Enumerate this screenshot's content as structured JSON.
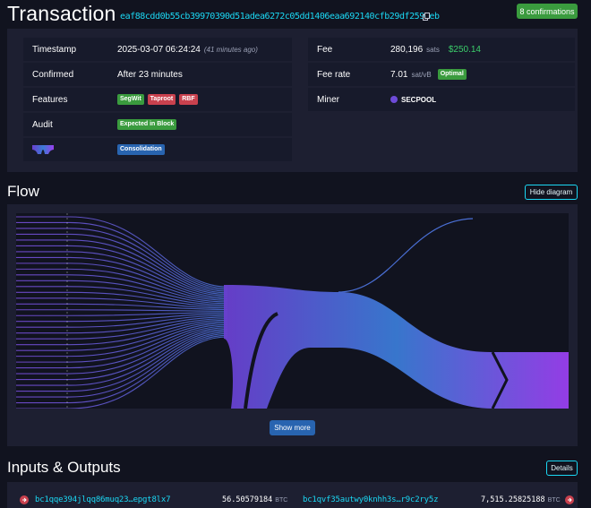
{
  "header": {
    "title": "Transaction",
    "txid": "eaf88cdd0b55cb39970390d51adea6272c05dd1406eaa692140cfb29df2599eb",
    "confirmations": "8 confirmations"
  },
  "details": {
    "timestamp": {
      "label": "Timestamp",
      "value": "2025-03-07 06:24:24",
      "relative": "(41 minutes ago)"
    },
    "confirmed": {
      "label": "Confirmed",
      "value": "After 23 minutes"
    },
    "features": {
      "label": "Features",
      "badges": [
        "SegWit",
        "Taproot",
        "RBF"
      ]
    },
    "audit": {
      "label": "Audit",
      "badge": "Expected in Block"
    },
    "cluster": {
      "badge": "Consolidation"
    },
    "fee": {
      "label": "Fee",
      "value": "280,196",
      "unit": "sats",
      "usd": "$250.14"
    },
    "fee_rate": {
      "label": "Fee rate",
      "value": "7.01",
      "unit": "sat/vB",
      "badge": "Optimal"
    },
    "miner": {
      "label": "Miner",
      "value": "SECPOOL"
    }
  },
  "flow": {
    "title": "Flow",
    "hide_label": "Hide diagram",
    "show_more_label": "Show more"
  },
  "io": {
    "title": "Inputs & Outputs",
    "details_label": "Details",
    "input": {
      "address": "bc1qqe394jlqq86muq23…epgt8lx7",
      "amount": "56.50579184",
      "unit": "BTC"
    },
    "output": {
      "address": "bc1qvf35autwy0knhh3s…r9c2ry5z",
      "amount": "7,515.25825188",
      "unit": "BTC"
    }
  },
  "colors": {
    "accent": "#1bd8f4",
    "success": "#3a9b3e",
    "danger": "#c9414e",
    "primary": "#2864b0",
    "flow_start": "#6a3fd0",
    "flow_mid": "#3a7bd5",
    "flow_end": "#9a3fef"
  }
}
